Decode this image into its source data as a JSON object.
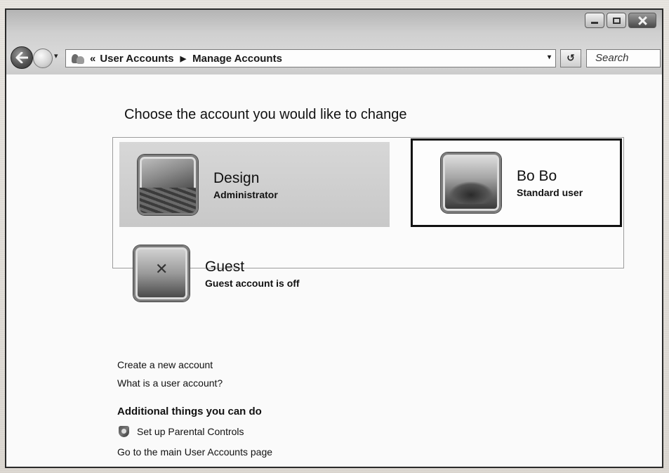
{
  "window": {
    "controls": {
      "minimize": "minimize-icon",
      "maximize": "maximize-icon",
      "close": "close-icon"
    }
  },
  "nav": {
    "back": "back-arrow-icon",
    "forward": "forward-arrow-icon",
    "history_dropdown": "▾",
    "address": {
      "prefix": "«",
      "crumbs": [
        "User Accounts",
        "Manage Accounts"
      ],
      "separator": "▶",
      "dropdown": "▾"
    },
    "refresh_glyph": "↺",
    "search_placeholder": "Search"
  },
  "main": {
    "heading": "Choose the account you would like to change",
    "accounts": [
      {
        "name": "Design",
        "role": "Administrator"
      },
      {
        "name": "Bo Bo",
        "role": "Standard user",
        "highlighted": true
      },
      {
        "name": "Guest",
        "role": "Guest account is off"
      }
    ],
    "links": {
      "create": "Create a new account",
      "what_is": "What is a user account?"
    },
    "additional": {
      "title": "Additional things you can do",
      "parental_controls": "Set up Parental Controls",
      "main_page": "Go to the main User Accounts page"
    }
  }
}
